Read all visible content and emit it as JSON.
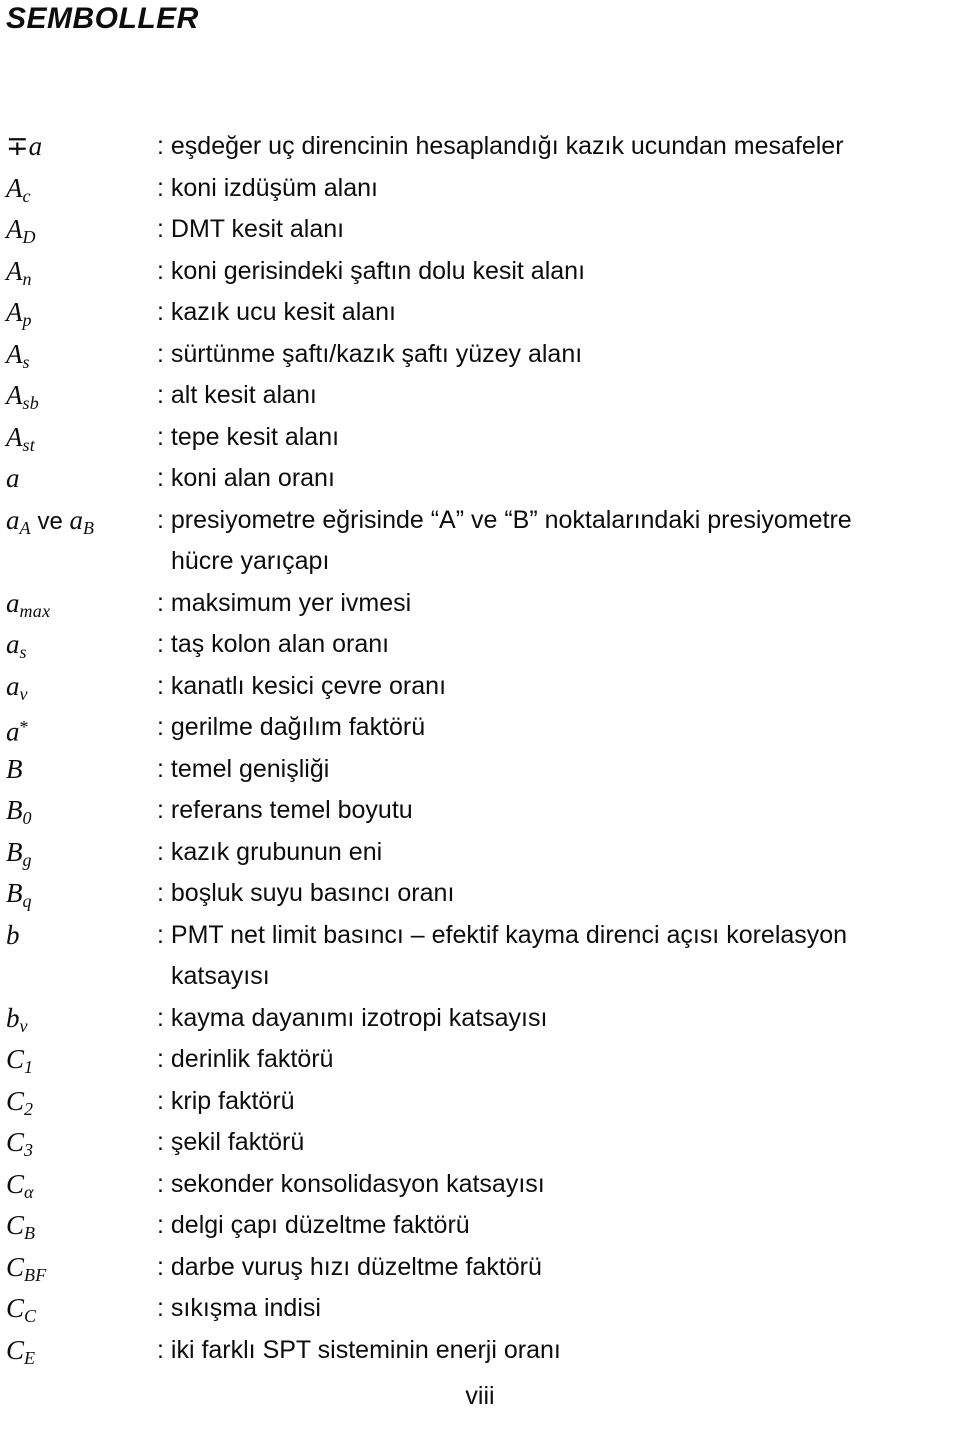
{
  "document": {
    "title": "SEMBOLLER",
    "page_number": "viii"
  },
  "symbols": [
    {
      "symbol_plain": "∓a",
      "description": ": eşdeğer uç direncinin hesaplandığı kazık ucundan mesafeler"
    },
    {
      "symbol_plain": "A_c",
      "description": ": koni izdüşüm alanı"
    },
    {
      "symbol_plain": "A_D",
      "description": ": DMT kesit alanı"
    },
    {
      "symbol_plain": "A_n",
      "description": ": koni gerisindeki şaftın dolu kesit alanı"
    },
    {
      "symbol_plain": "A_p",
      "description": ": kazık ucu kesit alanı"
    },
    {
      "symbol_plain": "A_s",
      "description": ": sürtünme şaftı/kazık şaftı yüzey alanı"
    },
    {
      "symbol_plain": "A_sb",
      "description": ": alt kesit alanı"
    },
    {
      "symbol_plain": "A_st",
      "description": ": tepe kesit alanı"
    },
    {
      "symbol_plain": "a",
      "description": ": koni alan oranı"
    },
    {
      "symbol_plain": "a_A ve a_B",
      "description": ": presiyometre eğrisinde “A” ve “B” noktalarındaki presiyometre",
      "continuation": "hücre yarıçapı"
    },
    {
      "symbol_plain": "a_max",
      "description": ": maksimum yer ivmesi"
    },
    {
      "symbol_plain": "a_s",
      "description": ": taş kolon alan oranı"
    },
    {
      "symbol_plain": "a_v",
      "description": ": kanatlı kesici çevre oranı"
    },
    {
      "symbol_plain": "a*",
      "description": ": gerilme dağılım faktörü"
    },
    {
      "symbol_plain": "B",
      "description": ": temel genişliği"
    },
    {
      "symbol_plain": "B_0",
      "description": ": referans temel boyutu"
    },
    {
      "symbol_plain": "B_g",
      "description": ": kazık grubunun eni"
    },
    {
      "symbol_plain": "B_q",
      "description": ": boşluk suyu basıncı oranı"
    },
    {
      "symbol_plain": "b",
      "description": ": PMT net limit basıncı – efektif kayma direnci açısı korelasyon",
      "continuation": "katsayısı"
    },
    {
      "symbol_plain": "b_v",
      "description": ": kayma dayanımı izotropi katsayısı"
    },
    {
      "symbol_plain": "C_1",
      "description": ": derinlik faktörü"
    },
    {
      "symbol_plain": "C_2",
      "description": ": krip faktörü"
    },
    {
      "symbol_plain": "C_3",
      "description": ": şekil faktörü"
    },
    {
      "symbol_plain": "C_α",
      "description": ": sekonder konsolidasyon katsayısı"
    },
    {
      "symbol_plain": "C_B",
      "description": ": delgi çapı düzeltme faktörü"
    },
    {
      "symbol_plain": "C_BF",
      "description": ": darbe vuruş hızı düzeltme faktörü"
    },
    {
      "symbol_plain": "C_C",
      "description": ": sıkışma indisi"
    },
    {
      "symbol_plain": "C_E",
      "description": ": iki farklı SPT sisteminin enerji oranı"
    }
  ],
  "symbol_glyphs": [
    {
      "base": "∓a",
      "kind": "op-plain"
    },
    {
      "base": "A",
      "sub": "c"
    },
    {
      "base": "A",
      "sub": "D"
    },
    {
      "base": "A",
      "sub": "n"
    },
    {
      "base": "A",
      "sub": "p"
    },
    {
      "base": "A",
      "sub": "s"
    },
    {
      "base": "A",
      "sub": "sb"
    },
    {
      "base": "A",
      "sub": "st"
    },
    {
      "base": "a"
    },
    {
      "base": "a",
      "sub": "A",
      "conj": "ve",
      "base2": "a",
      "sub2": "B"
    },
    {
      "base": "a",
      "sub": "max"
    },
    {
      "base": "a",
      "sub": "s"
    },
    {
      "base": "a",
      "sub": "v"
    },
    {
      "base": "a",
      "sup": "*"
    },
    {
      "base": "B"
    },
    {
      "base": "B",
      "sub": "0"
    },
    {
      "base": "B",
      "sub": "g"
    },
    {
      "base": "B",
      "sub": "q"
    },
    {
      "base": "b"
    },
    {
      "base": "b",
      "sub": "v"
    },
    {
      "base": "C",
      "sub": "1"
    },
    {
      "base": "C",
      "sub": "2"
    },
    {
      "base": "C",
      "sub": "3"
    },
    {
      "base": "C",
      "sub": "α"
    },
    {
      "base": "C",
      "sub": "B"
    },
    {
      "base": "C",
      "sub": "BF"
    },
    {
      "base": "C",
      "sub": "C"
    },
    {
      "base": "C",
      "sub": "E"
    }
  ]
}
